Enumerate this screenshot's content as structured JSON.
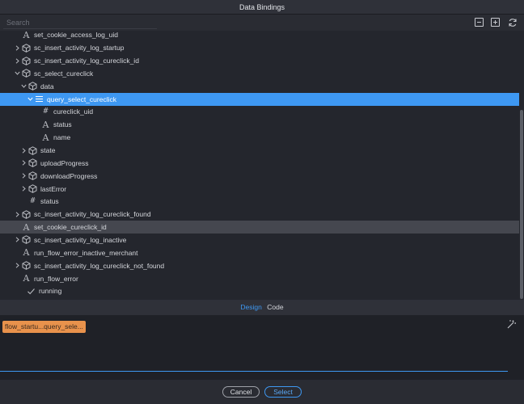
{
  "title": "Data Bindings",
  "search": {
    "placeholder": "Search",
    "value": ""
  },
  "toolbar": {
    "icons": [
      "collapse-all-icon",
      "expand-all-icon",
      "refresh-icon"
    ]
  },
  "tree": [
    {
      "label": "set_cookie_access_log_uid",
      "icon": "text-icon",
      "indent": 0,
      "chevron": "none"
    },
    {
      "label": "sc_insert_activity_log_startup",
      "icon": "cube-icon",
      "indent": 0,
      "chevron": "right"
    },
    {
      "label": "sc_insert_activity_log_cureclick_id",
      "icon": "cube-icon",
      "indent": 0,
      "chevron": "right"
    },
    {
      "label": "sc_select_cureclick",
      "icon": "cube-icon",
      "indent": 0,
      "chevron": "down"
    },
    {
      "label": "data",
      "icon": "cube-icon",
      "indent": 1,
      "chevron": "down"
    },
    {
      "label": "query_select_cureclick",
      "icon": "list-icon",
      "indent": 2,
      "chevron": "down",
      "state": "selected"
    },
    {
      "label": "cureclick_uid",
      "icon": "number-icon",
      "indent": 3,
      "chevron": "none"
    },
    {
      "label": "status",
      "icon": "text-icon",
      "indent": 3,
      "chevron": "none"
    },
    {
      "label": "name",
      "icon": "text-icon",
      "indent": 3,
      "chevron": "none"
    },
    {
      "label": "state",
      "icon": "cube-icon",
      "indent": 1,
      "chevron": "right"
    },
    {
      "label": "uploadProgress",
      "icon": "cube-icon",
      "indent": 1,
      "chevron": "right"
    },
    {
      "label": "downloadProgress",
      "icon": "cube-icon",
      "indent": 1,
      "chevron": "right"
    },
    {
      "label": "lastError",
      "icon": "cube-icon",
      "indent": 1,
      "chevron": "right"
    },
    {
      "label": "status",
      "icon": "number-icon",
      "indent": 1,
      "chevron": "none"
    },
    {
      "label": "sc_insert_activity_log_cureclick_found",
      "icon": "cube-icon",
      "indent": 0,
      "chevron": "right"
    },
    {
      "label": "set_cookie_cureclick_id",
      "icon": "text-icon",
      "indent": 0,
      "chevron": "none",
      "state": "hovered"
    },
    {
      "label": "sc_insert_activity_log_inactive",
      "icon": "cube-icon",
      "indent": 0,
      "chevron": "right"
    },
    {
      "label": "run_flow_error_inactive_merchant",
      "icon": "text-icon",
      "indent": 0,
      "chevron": "none"
    },
    {
      "label": "sc_insert_activity_log_cureclick_not_found",
      "icon": "cube-icon",
      "indent": 0,
      "chevron": "right"
    },
    {
      "label": "run_flow_error",
      "icon": "text-icon",
      "indent": 0,
      "chevron": "none"
    },
    {
      "label": "running",
      "icon": "check-icon",
      "indent": -1,
      "chevron": "none"
    }
  ],
  "tabs": [
    {
      "label": "Design",
      "active": true
    },
    {
      "label": "Code",
      "active": false
    }
  ],
  "editor": {
    "token": "flow_startu...query_sele..."
  },
  "buttons": {
    "cancel": "Cancel",
    "select": "Select"
  },
  "colors": {
    "accent": "#3e98f2",
    "token": "#e8924c",
    "background": "#24262d"
  }
}
